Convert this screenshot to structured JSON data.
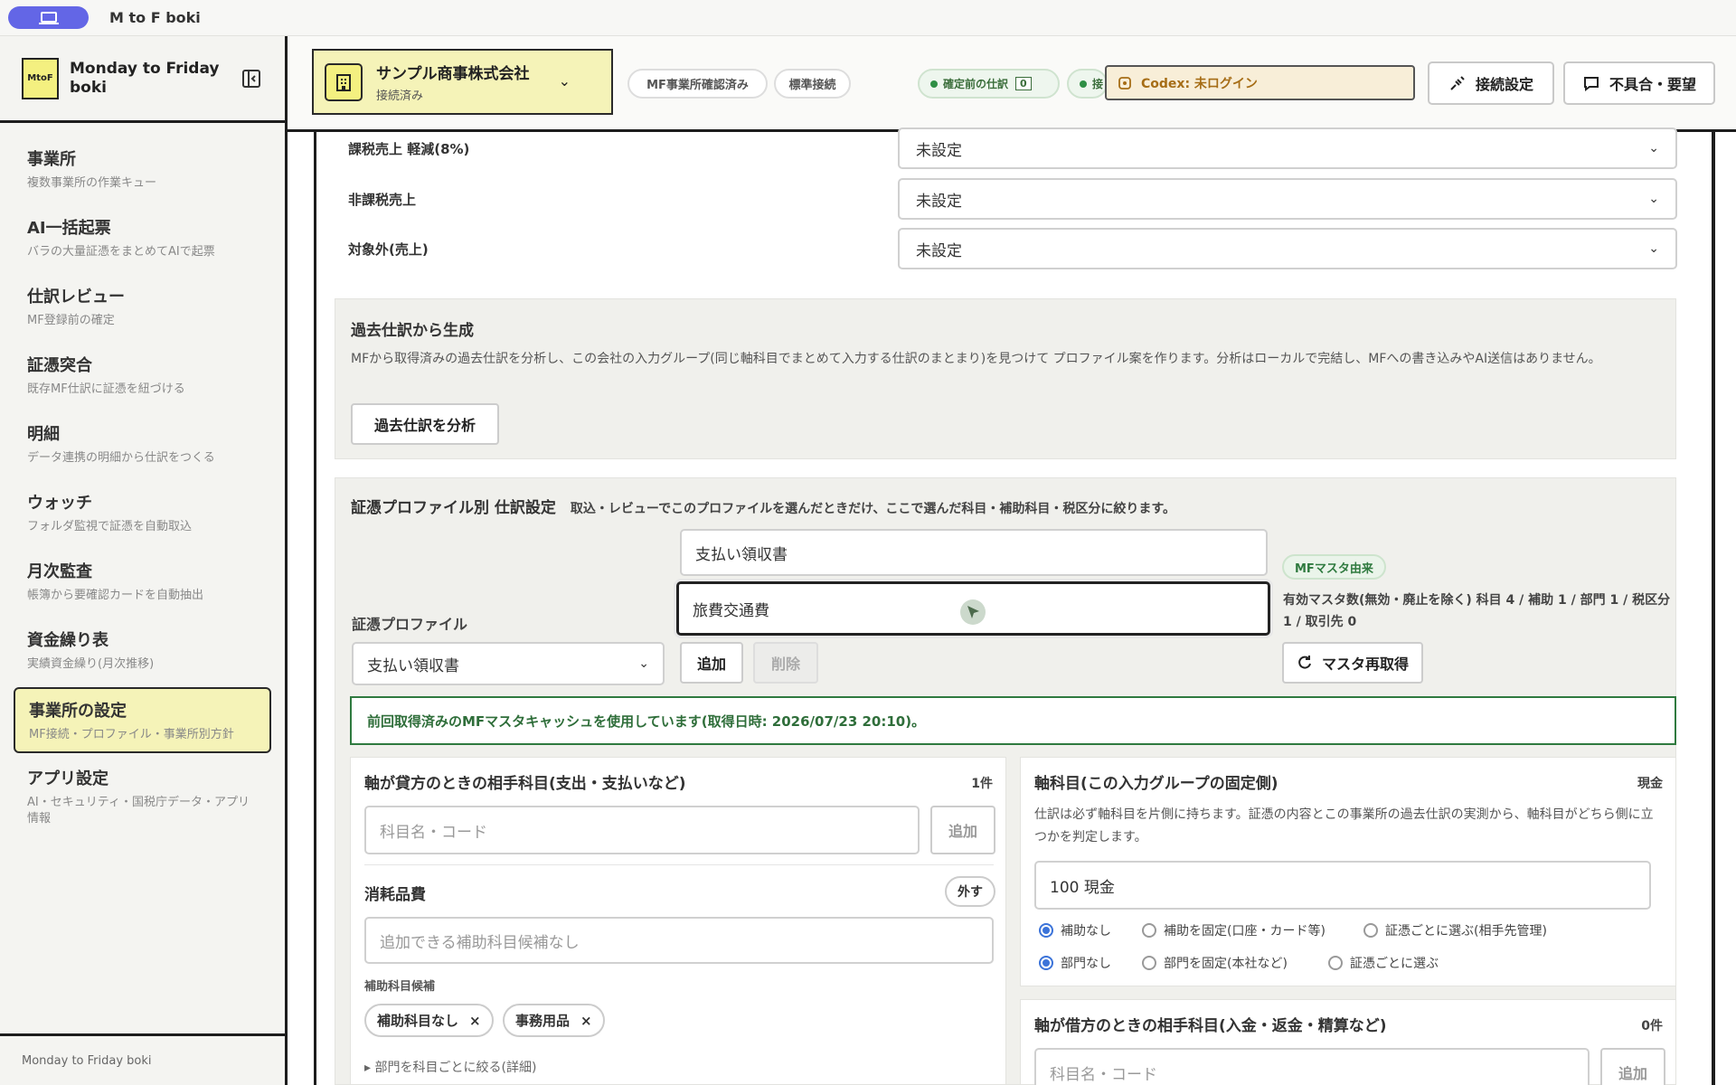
{
  "window": {
    "title": "M to F boki"
  },
  "sidebar": {
    "logo": "MtoF",
    "brand": "Monday to Friday boki",
    "items": [
      {
        "label": "事業所",
        "sub": "複数事業所の作業キュー"
      },
      {
        "label": "AI一括起票",
        "sub": "バラの大量証憑をまとめてAIで起票"
      },
      {
        "label": "仕訳レビュー",
        "sub": "MF登録前の確定"
      },
      {
        "label": "証憑突合",
        "sub": "既存MF仕訳に証憑を紐づける"
      },
      {
        "label": "明細",
        "sub": "データ連携の明細から仕訳をつくる"
      },
      {
        "label": "ウォッチ",
        "sub": "フォルダ監視で証憑を自動取込"
      },
      {
        "label": "月次監査",
        "sub": "帳簿から要確認カードを自動抽出"
      },
      {
        "label": "資金繰り表",
        "sub": "実績資金繰り(月次推移)"
      },
      {
        "label": "事業所の設定",
        "sub": "MF接続・プロファイル・事業所別方針"
      },
      {
        "label": "アプリ設定",
        "sub": "AI・セキュリティ・国税庁データ・アプリ情報"
      }
    ],
    "footer": "Monday to Friday boki"
  },
  "header": {
    "company_name": "サンプル商事株式会社",
    "company_status": "接続済み",
    "pill_mf": "MF事業所確認済み",
    "pill_std": "標準接続",
    "pending_label": "確定前の仕訳",
    "pending_count": "0",
    "status2": "接",
    "codex": "Codex: 未ログイン",
    "connect_btn": "接続設定",
    "report_btn": "不具合・要望"
  },
  "tax_rows": [
    {
      "label": "課税売上 軽減(8%)",
      "value": "未設定"
    },
    {
      "label": "非課税売上",
      "value": "未設定"
    },
    {
      "label": "対象外(売上)",
      "value": "未設定"
    }
  ],
  "past": {
    "title": "過去仕訳から生成",
    "desc": "MFから取得済みの過去仕訳を分析し、この会社の入力グループ(同じ軸科目でまとめて入力する仕訳のまとまり)を見つけて プロファイル案を作ります。分析はローカルで完結し、MFへの書き込みやAI送信はありません。",
    "button": "過去仕訳を分析"
  },
  "profile": {
    "title": "証憑プロファイル別 仕訳設定",
    "desc": "取込・レビューでこのプロファイルを選んだときだけ、ここで選んだ科目・補助科目・税区分に絞ります。",
    "name_input": "支払い領収書",
    "account_input": "旅費交通費",
    "select_label": "証憑プロファイル",
    "select_value": "支払い領収書",
    "add": "追加",
    "delete": "削除",
    "mf_badge": "MFマスタ由来",
    "master_info": "有効マスタ数(無効・廃止を除く) 科目 4 / 補助 1 / 部門 1 / 税区分 1 / 取引先 0",
    "refresh": "マスタ再取得",
    "notice": "前回取得済みのMFマスタキャッシュを使用しています(取得日時: 2026/07/23 20:10)。"
  },
  "credit_card": {
    "title": "軸が貸方のときの相手科目(支出・支払いなど)",
    "count": "1件",
    "placeholder": "科目名・コード",
    "add": "追加",
    "item": "消耗品費",
    "remove": "外す",
    "sub_placeholder": "追加できる補助科目候補なし",
    "sub_label": "補助科目候補",
    "chips": [
      "補助科目なし",
      "事務用品"
    ],
    "details": "▸ 部門を科目ごとに絞る(詳細)"
  },
  "axis_card": {
    "title": "軸科目(この入力グループの固定側)",
    "tag": "現金",
    "desc": "仕訳は必ず軸科目を片側に持ちます。証憑の内容とこの事業所の過去仕訳の実測から、軸科目がどちら側に立つかを判定します。",
    "value": "100 現金",
    "radios1": [
      "補助なし",
      "補助を固定(口座・カード等)",
      "証憑ごとに選ぶ(相手先管理)"
    ],
    "radios2": [
      "部門なし",
      "部門を固定(本社など)",
      "証憑ごとに選ぶ"
    ]
  },
  "debit_card": {
    "title": "軸が借方のときの相手科目(入金・返金・精算など)",
    "count": "0件",
    "placeholder": "科目名・コード",
    "add": "追加"
  }
}
